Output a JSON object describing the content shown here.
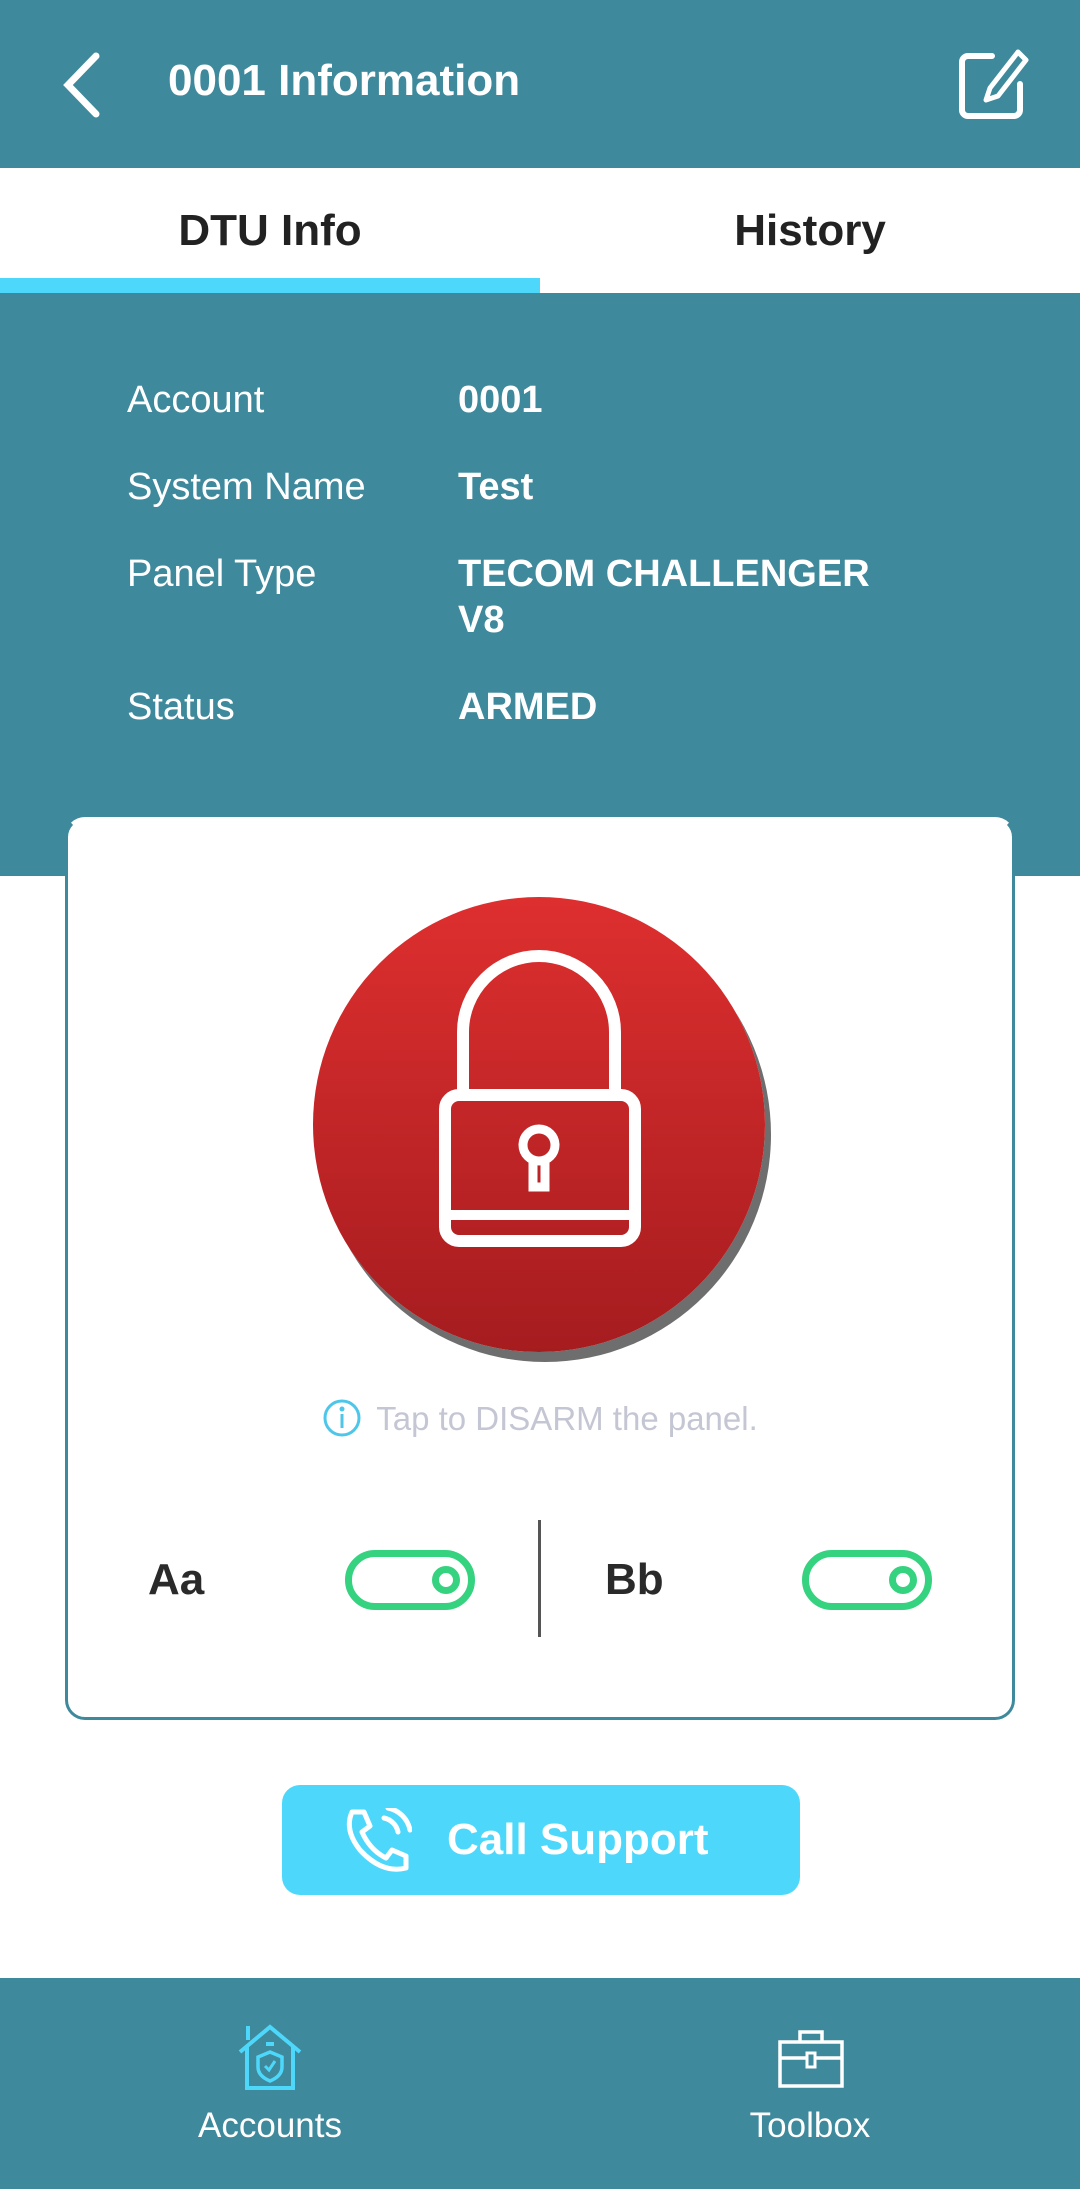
{
  "header": {
    "title": "0001 Information",
    "back_icon": "chevron-left-icon",
    "edit_icon": "edit-icon"
  },
  "tabs": [
    {
      "label": "DTU Info",
      "active": true
    },
    {
      "label": "History",
      "active": false
    }
  ],
  "info": {
    "rows": [
      {
        "label": "Account",
        "value": "0001"
      },
      {
        "label": "System Name",
        "value": "Test"
      },
      {
        "label": "Panel Type",
        "value": "TECOM CHALLENGER V8"
      },
      {
        "label": "Status",
        "value": "ARMED"
      }
    ]
  },
  "panel": {
    "lock_icon": "padlock-icon",
    "hint": "Tap to DISARM the panel.",
    "toggles": [
      {
        "label": "Aa",
        "on": true
      },
      {
        "label": "Bb",
        "on": true
      }
    ]
  },
  "call_support": {
    "label": "Call Support",
    "icon": "phone-icon"
  },
  "nav": [
    {
      "label": "Accounts",
      "icon": "home-shield-icon",
      "active": true
    },
    {
      "label": "Toolbox",
      "icon": "toolbox-icon",
      "active": false
    }
  ],
  "colors": {
    "primary": "#3e899b",
    "accent": "#4dd8fb",
    "armed": "#d92b2b",
    "toggle": "#35d27f"
  }
}
